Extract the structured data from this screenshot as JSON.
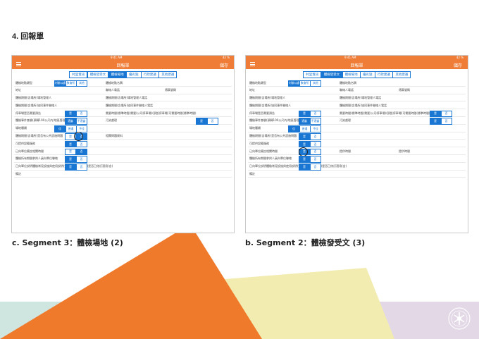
{
  "heading": "4. 回報單",
  "captions": {
    "left": "c. Segment  3：體檢場地 (2)",
    "right": "b. Segment  2：體檢發受文 (3)"
  },
  "colors": {
    "accent_orange": "#ef7d37",
    "accent_blue": "#1976d2",
    "deco_orange": "#f07a2c",
    "deco_yellow": "#f2ecb0",
    "deco_teal": "#cfe5e0",
    "deco_lilac": "#e3d8e6"
  },
  "app": {
    "status_time": "9:41 AM",
    "status_battery": "42 %",
    "title": "回報單",
    "save": "儲存",
    "menu_icon": "hamburger-icon",
    "tabs": [
      "村里資訊",
      "體檢發受文",
      "體檢場地",
      "優劣點",
      "行政建議",
      "其他建議"
    ]
  },
  "left_screen": {
    "active_tab": 2,
    "rows": [
      {
        "label": "體檢地點類型",
        "options": [
          "村辦公處",
          "聚會所",
          "其他"
        ],
        "selected": 0,
        "label2": "體檢地點名稱"
      },
      {
        "label": "地址",
        "label2": "聯絡人電話",
        "label3": "傳真號碼"
      },
      {
        "label": "體檢期間(含場所)場地管理人",
        "label2": "體檢期間(含場所)場地管理人電話"
      },
      {
        "label": "體檢期間(含場所)協同事件聯絡人",
        "label2": "體檢期間(含場所)協同事件聯絡人電話"
      },
      {
        "label": "停車場是否需要預告",
        "options": [
          "是",
          "否"
        ],
        "selected": 0,
        "label2": "需要時間(標準時間)需要(公司停車場)(預設停車場)可需要時間(標準時間)"
      },
      {
        "label": "體檢事件查驗(預轉100公尺內)地區管理處",
        "options": [
          "適當",
          "不適當"
        ],
        "selected": 0,
        "label2": "污染處理",
        "options2": [
          "是",
          "否"
        ],
        "selected2": 0
      },
      {
        "label": "場地種類",
        "options": [
          "佳",
          "普通",
          "不佳"
        ],
        "selected": 0
      },
      {
        "label": "體檢期間(含場所)是否有公共設施問題",
        "options": [
          "是",
          "否"
        ],
        "selected": 1,
        "circled": true,
        "label2": "相關問題資料"
      },
      {
        "label": "可提供設備服務",
        "options": [
          "是",
          "否"
        ],
        "selected": 0
      },
      {
        "label": "已向單位備註相關時間",
        "options": [
          "是",
          "否"
        ],
        "selected": 1
      },
      {
        "label": "體檢所有期間參與人員向單位聯絡",
        "options": [
          "是",
          "否"
        ],
        "selected": 0
      },
      {
        "label": "已向單位說明體檢常見設施與使用說明(完整、合乎、採購)是否已修訂適用(含)",
        "options": [
          "是",
          "否"
        ],
        "selected": 0
      },
      {
        "label": "備註"
      }
    ]
  },
  "right_screen": {
    "active_tab": 1,
    "rows": [
      {
        "label": "體檢地點類型",
        "options": [
          "村辦公處",
          "聚會所",
          "其他"
        ],
        "selected": 0,
        "label2": "體檢地點名稱"
      },
      {
        "label": "地址",
        "label2": "聯絡人電話",
        "label3": "傳真號碼"
      },
      {
        "label": "體檢期間(含場所)場地管理人",
        "label2": "體檢期間(含場所)場地管理人電話"
      },
      {
        "label": "體檢期間(含場所)協同事件聯絡人",
        "label2": "體檢期間(含場所)協同事件聯絡人電話"
      },
      {
        "label": "停車場是否需要預告",
        "options": [
          "是",
          "否"
        ],
        "selected": 0,
        "label2": "需要時間(標準時間)需要(公司停車場)(預設停車場)可需要時間(標準時間)",
        "options2": [
          "是",
          "否"
        ],
        "selected2": 0
      },
      {
        "label": "體檢事件查驗(預轉100公尺內)地區管理處",
        "options": [
          "適當",
          "不適當"
        ],
        "selected": 0,
        "label2": "污染處理",
        "options2": [
          "是",
          "否"
        ],
        "selected2": 0
      },
      {
        "label": "場地種類",
        "options": [
          "佳",
          "普通",
          "不佳"
        ],
        "selected": 0
      },
      {
        "label": "體檢期間(含場所)是否有公共設施問題",
        "options": [
          "是",
          "否"
        ],
        "selected": 0
      },
      {
        "label": "可提供設備服務",
        "options": [
          "是",
          "否"
        ],
        "selected": 0
      },
      {
        "label": "已向單位備註相關時間",
        "options": [
          "是",
          "否"
        ],
        "selected": 0,
        "circled": true,
        "label2": "提供時間",
        "label3": "提供時間"
      },
      {
        "label": "體檢所有期間參與人員向單位聯絡",
        "options": [
          "是",
          "否"
        ],
        "selected": 0
      },
      {
        "label": "已向單位說明體檢常見設施與使用說明(完整、合乎、採購)是否已修訂適用(含)",
        "options": [
          "是",
          "否"
        ],
        "selected": 0
      },
      {
        "label": "備註"
      }
    ]
  }
}
